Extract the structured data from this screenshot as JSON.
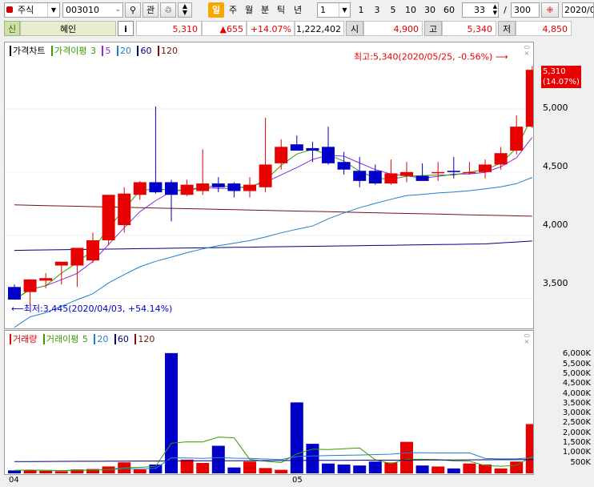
{
  "toolbar": {
    "market": "주식",
    "code": "003010",
    "btn_favorite": "관",
    "periods": [
      "일",
      "주",
      "월",
      "분",
      "틱",
      "년"
    ],
    "interval": "1",
    "interval_buttons": [
      "1",
      "3",
      "5",
      "10",
      "30",
      "60"
    ],
    "bar_count": "33",
    "separator": "/",
    "bar_total": "300",
    "date": "2020/05/25"
  },
  "quote": {
    "badge": "신",
    "name": "혜인",
    "info_button": "i",
    "price": "5,310",
    "change": "▲655",
    "change_rate": "+14.07%",
    "volume": "1,222,402",
    "open_label": "시",
    "open": "4,900",
    "high_label": "고",
    "high": "5,340",
    "low_label": "저",
    "low": "4,850"
  },
  "price_panel": {
    "legend": {
      "title": "가격차트",
      "ma_title": "가격이평",
      "periods": [
        "3",
        "5",
        "20",
        "60",
        "120"
      ]
    },
    "current_price": "5,310",
    "current_rate": "(14.07%)",
    "high_annotation": "최고:5,340(2020/05/25, -0.56%)",
    "low_annotation": "최저:3,445(2020/04/03, +54.14%)",
    "y_ticks": [
      "3,500",
      "4,000",
      "4,500",
      "5,000"
    ]
  },
  "volume_panel": {
    "legend": {
      "title": "거래량",
      "ma_title": "거래이평",
      "periods": [
        "5",
        "20",
        "60",
        "120"
      ]
    },
    "y_ticks": [
      "500K",
      "1,000K",
      "1,500K",
      "2,000K",
      "2,500K",
      "3,000K",
      "3,500K",
      "4,000K",
      "4,500K",
      "5,000K",
      "5,500K",
      "6,000K"
    ]
  },
  "x_axis": {
    "labels": [
      "04",
      "05"
    ]
  },
  "colors": {
    "up": "#e60000",
    "down": "#0000c8",
    "ma3": "#3a9a00",
    "ma5": "#8a2be2",
    "ma20": "#1e7fd0",
    "ma60": "#000080",
    "ma120": "#7a1010"
  },
  "chart_data": {
    "type": "candlestick",
    "dates": [
      "2020/04/01",
      "2020/04/02",
      "2020/04/03",
      "2020/04/06",
      "2020/04/07",
      "2020/04/08",
      "2020/04/09",
      "2020/04/10",
      "2020/04/13",
      "2020/04/14",
      "2020/04/16",
      "2020/04/17",
      "2020/04/20",
      "2020/04/21",
      "2020/04/22",
      "2020/04/23",
      "2020/04/24",
      "2020/04/27",
      "2020/04/28",
      "2020/04/29",
      "2020/05/04",
      "2020/05/06",
      "2020/05/07",
      "2020/05/08",
      "2020/05/11",
      "2020/05/12",
      "2020/05/13",
      "2020/05/14",
      "2020/05/15",
      "2020/05/18",
      "2020/05/19",
      "2020/05/20",
      "2020/05/21",
      "2020/05/22",
      "2020/05/25"
    ],
    "open": [
      3590,
      3550,
      3640,
      3760,
      3760,
      3800,
      3960,
      4080,
      4320,
      4420,
      4420,
      4320,
      4350,
      4410,
      4410,
      4350,
      4380,
      4570,
      4720,
      4690,
      4700,
      4580,
      4510,
      4510,
      4410,
      4470,
      4470,
      4500,
      4510,
      4500,
      4500,
      4560,
      4670,
      4860
    ],
    "high": [
      3610,
      3610,
      3700,
      3790,
      3900,
      4020,
      4300,
      4380,
      4430,
      5020,
      4440,
      4440,
      4680,
      4460,
      4420,
      4460,
      4930,
      4760,
      4790,
      4740,
      4860,
      4660,
      4620,
      4560,
      4600,
      4580,
      4570,
      4580,
      4620,
      4580,
      4600,
      4700,
      4950,
      5340
    ],
    "low": [
      3550,
      3445,
      3580,
      3610,
      3590,
      3780,
      3920,
      4020,
      4280,
      4330,
      4110,
      4310,
      4320,
      4340,
      4300,
      4300,
      4340,
      4520,
      4700,
      4580,
      4560,
      4480,
      4380,
      4400,
      4400,
      4420,
      4440,
      4430,
      4450,
      4480,
      4450,
      4520,
      4640,
      4850
    ],
    "close": [
      3490,
      3650,
      3660,
      3790,
      3900,
      3960,
      4320,
      4330,
      4420,
      4340,
      4320,
      4400,
      4410,
      4380,
      4350,
      4400,
      4560,
      4700,
      4670,
      4670,
      4570,
      4520,
      4430,
      4410,
      4490,
      4500,
      4430,
      4500,
      4500,
      4500,
      4560,
      4650,
      4860,
      5310
    ],
    "volume_k": [
      150,
      180,
      130,
      110,
      200,
      220,
      350,
      560,
      200,
      450,
      6100,
      700,
      530,
      1400,
      300,
      600,
      270,
      180,
      3600,
      1500,
      500,
      450,
      400,
      600,
      550,
      1600,
      400,
      350,
      250,
      500,
      450,
      250,
      600,
      2500,
      1200
    ],
    "y_range": [
      3300,
      5400
    ],
    "volume_y_range_k": [
      0,
      6500
    ]
  }
}
